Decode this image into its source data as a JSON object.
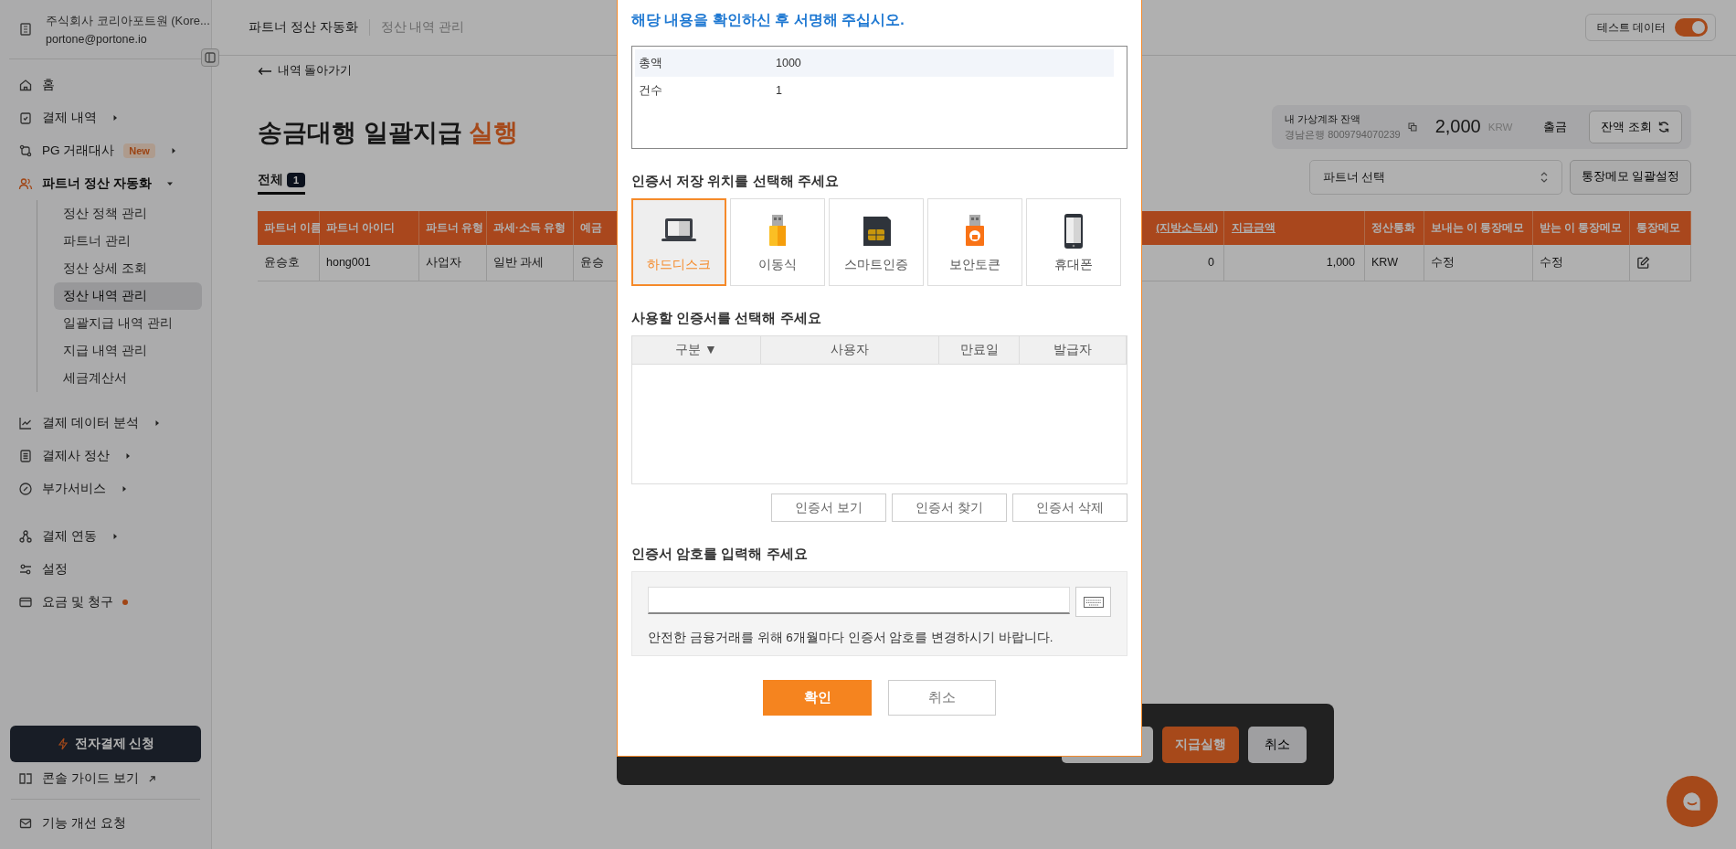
{
  "sidebar": {
    "company": "주식회사 코리아포트원 (Kore...",
    "email": "portone@portone.io",
    "sections": [
      {
        "items": [
          {
            "label": "홈",
            "kind": "link",
            "selected": false
          },
          {
            "label": "결제 내역",
            "kind": "group",
            "selected": false,
            "expanded": false
          },
          {
            "label": "PG 거래대사",
            "kind": "group",
            "selected": false,
            "expanded": false,
            "badge": "New"
          },
          {
            "label": "파트너 정산 자동화",
            "kind": "group",
            "selected": true,
            "expanded": true,
            "children": [
              {
                "label": "정산 정책 관리",
                "selected": false
              },
              {
                "label": "파트너 관리",
                "selected": false
              },
              {
                "label": "정산 상세 조회",
                "selected": false
              },
              {
                "label": "정산 내역 관리",
                "selected": true
              },
              {
                "label": "일괄지급 내역 관리",
                "selected": false
              },
              {
                "label": "지급 내역 관리",
                "selected": false
              },
              {
                "label": "세금계산서",
                "selected": false
              }
            ]
          }
        ]
      },
      {
        "items": [
          {
            "label": "결제 데이터 분석",
            "kind": "group",
            "selected": false,
            "expanded": false
          },
          {
            "label": "결제사 정산",
            "kind": "group",
            "selected": false,
            "expanded": false
          },
          {
            "label": "부가서비스",
            "kind": "group",
            "selected": false,
            "expanded": false
          }
        ]
      },
      {
        "items": [
          {
            "label": "결제 연동",
            "kind": "group",
            "selected": false,
            "expanded": false
          },
          {
            "label": "설정",
            "kind": "link",
            "selected": false
          },
          {
            "label": "요금 및 청구",
            "kind": "link",
            "selected": false,
            "dot": true
          }
        ]
      }
    ],
    "cta": "전자결제 신청",
    "guide_link": "콘솔 가이드 보기",
    "feedback": "기능 개선 요청"
  },
  "header": {
    "breadcrumb": [
      "파트너 정산 자동화",
      "정산 내역 관리"
    ],
    "test_toggle": {
      "label": "테스트 데이터",
      "on": true
    }
  },
  "page": {
    "back_link": "내역 돌아가기",
    "title": "송금대행 일괄지급",
    "title_highlight": "실행",
    "balance": {
      "label": "내 가상계좌 잔액",
      "account": "경남은행 8009794070239",
      "amount": "2,000",
      "currency": "KRW",
      "withdraw": "출금",
      "refresh": "잔액 조회"
    },
    "tabs": [
      {
        "label": "전체",
        "count": "1",
        "selected": true
      }
    ],
    "partner_select": {
      "placeholder": "파트너 선택"
    },
    "memo_button": "통장메모 일괄설정",
    "table": {
      "columns": [
        {
          "label": "파트너 이름",
          "kind": "text",
          "underlined": false
        },
        {
          "label": "파트너 아이디",
          "kind": "text",
          "underlined": false
        },
        {
          "label": "파트너 유형",
          "kind": "text",
          "underlined": false
        },
        {
          "label": "과세·소득 유형",
          "kind": "text",
          "underlined": false
        },
        {
          "label": "예금",
          "kind": "text",
          "underlined": false
        },
        {
          "label": "(지방소득세)",
          "kind": "number",
          "underlined": true
        },
        {
          "label": "지급금액",
          "kind": "number",
          "underlined": true
        },
        {
          "label": "정산통화",
          "kind": "text",
          "underlined": false
        },
        {
          "label": "보내는 이 통장메모",
          "kind": "text",
          "underlined": false
        },
        {
          "label": "받는 이 통장메모",
          "kind": "text",
          "underlined": false
        },
        {
          "label": "통장메모",
          "kind": "icon",
          "underlined": false
        }
      ],
      "rows": [
        {
          "cells": [
            "윤승호",
            "hong001",
            "사업자",
            "일반 과세",
            "윤승",
            "0",
            "1,000",
            "KRW",
            "수정",
            "수정"
          ]
        }
      ]
    }
  },
  "bottom_bar": {
    "execute": "지급실행",
    "cancel": "취소"
  },
  "modal": {
    "title": "해당 내용을 확인하신 후 서명해 주십시오.",
    "summary": [
      {
        "label": "총액",
        "value": "1000",
        "selected": true
      },
      {
        "label": "건수",
        "value": "1",
        "selected": false
      }
    ],
    "storage_heading": "인증서 저장 위치를 선택해 주세요",
    "storage_options": [
      {
        "label": "하드디스크",
        "kind": "laptop",
        "selected": true
      },
      {
        "label": "이동식",
        "kind": "usb",
        "selected": false
      },
      {
        "label": "스마트인증",
        "kind": "card",
        "selected": false
      },
      {
        "label": "보안토큰",
        "kind": "token",
        "selected": false
      },
      {
        "label": "휴대폰",
        "kind": "phone",
        "selected": false
      }
    ],
    "cert_heading": "사용할 인증서를 선택해 주세요",
    "cert_columns": [
      "구분 ▼",
      "사용자",
      "만료일",
      "발급자"
    ],
    "cert_buttons": [
      "인증서 보기",
      "인증서 찾기",
      "인증서 삭제"
    ],
    "password_heading": "인증서 암호를 입력해 주세요",
    "password_note": "안전한 금융거래를 위해 6개월마다 인증서 암호를 변경하시기 바랍니다.",
    "confirm": "확인",
    "cancel": "취소"
  }
}
